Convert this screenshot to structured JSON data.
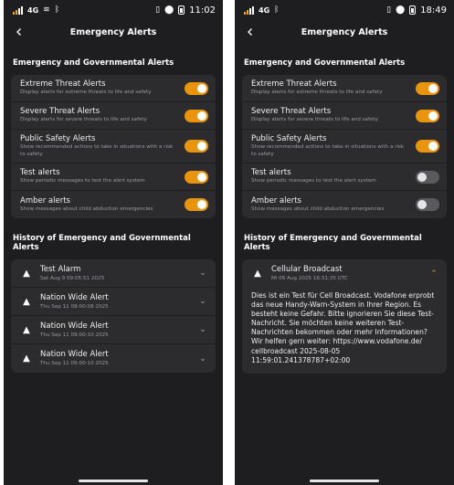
{
  "screens": {
    "left": {
      "status": {
        "network": "4G",
        "time": "11:02"
      },
      "title": "Emergency Alerts",
      "section_alerts": "Emergency and Governmental Alerts",
      "settings": [
        {
          "title": "Extreme Threat Alerts",
          "subtitle": "Display alerts for extreme threats to life and safety",
          "enabled": true
        },
        {
          "title": "Severe Threat Alerts",
          "subtitle": "Display alerts for severe threats to life and safety",
          "enabled": true
        },
        {
          "title": "Public Safety Alerts",
          "subtitle": "Show recommended actions to take in situations with a risk to safety",
          "enabled": true
        },
        {
          "title": "Test alerts",
          "subtitle": "Show periodic messages to test the alert system",
          "enabled": true
        },
        {
          "title": "Amber alerts",
          "subtitle": "Show messages about child abduction emergencies",
          "enabled": true
        }
      ],
      "section_history": "History of Emergency and Governmental Alerts",
      "history": [
        {
          "title": "Test Alarm",
          "subtitle": "Sat Aug  9 09:05:51 2025"
        },
        {
          "title": "Nation Wide Alert",
          "subtitle": "Thu Sep 11 09:00:08 2025"
        },
        {
          "title": "Nation Wide Alert",
          "subtitle": "Thu Sep 11 09:00:10 2025"
        },
        {
          "title": "Nation Wide Alert",
          "subtitle": "Thu Sep 11 09:00:10 2025"
        }
      ]
    },
    "right": {
      "status": {
        "network": "4G",
        "time": "18:49"
      },
      "title": "Emergency Alerts",
      "section_alerts": "Emergency and Governmental Alerts",
      "settings": [
        {
          "title": "Extreme Threat Alerts",
          "subtitle": "Display alerts for extreme threats to life and safety",
          "enabled": true
        },
        {
          "title": "Severe Threat Alerts",
          "subtitle": "Display alerts for severe threats to life and safety",
          "enabled": true
        },
        {
          "title": "Public Safety Alerts",
          "subtitle": "Show recommended actions to take in situations with a risk to safety",
          "enabled": true
        },
        {
          "title": "Test alerts",
          "subtitle": "Show periodic messages to test the alert system",
          "enabled": false
        },
        {
          "title": "Amber alerts",
          "subtitle": "Show messages about child abduction emergencies",
          "enabled": false
        }
      ],
      "section_history": "History of Emergency and Governmental Alerts",
      "history": [
        {
          "title": "Cellular Broadcast",
          "subtitle": "Mi 06 Aug 2025 16:31:35 UTC",
          "message": "Dies ist ein Test für Cell Broadcast. Vodafone erprobt das neue Handy-Warn-System in Ihrer Region. Es besteht keine Gefahr. Bitte ignorieren Sie diese Test-Nachricht. Sie möchten keine weiteren Test-Nachrichten bekommen oder mehr Informationen? Wir helfen gern weiter: https://www.vodafone.de/ cellbroadcast 2025-08-05 11:59:01.241378787+02:00"
        }
      ]
    }
  },
  "icons": {
    "back": "arrow-back-icon",
    "warning": "warning-triangle-icon",
    "expand": "chevron-down-icon",
    "collapse": "chevron-up-icon"
  },
  "colors": {
    "background": "#1e1e20",
    "card": "#2c2c2f",
    "accent": "#e8940f",
    "toggle_off": "#5a5a5e"
  }
}
